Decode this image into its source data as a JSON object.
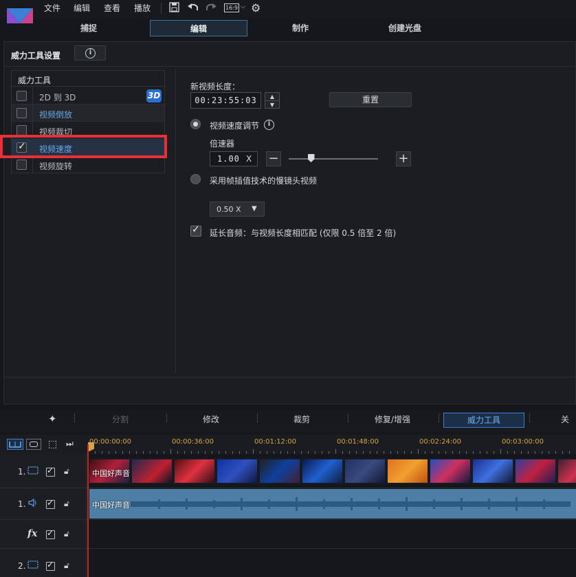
{
  "menu": [
    "文件",
    "编辑",
    "查看",
    "播放"
  ],
  "toolbar": {
    "aspect": "16:9"
  },
  "tabs": [
    {
      "label": "捕捉"
    },
    {
      "label": "编辑"
    },
    {
      "label": "制作"
    },
    {
      "label": "创建光盘"
    }
  ],
  "panel": {
    "title": "威力工具设置",
    "info": "i"
  },
  "tools": {
    "header": "威力工具",
    "items": [
      {
        "label": "2D 到 3D",
        "checked": false,
        "badge": "3D"
      },
      {
        "label": "视频倒放",
        "checked": false
      },
      {
        "label": "视频裁切",
        "checked": false
      },
      {
        "label": "视频速度",
        "checked": true
      },
      {
        "label": "视频旋转",
        "checked": false
      }
    ]
  },
  "settings": {
    "new_length_label": "新视频长度：",
    "new_length_value": "00:23:55:03",
    "reset_label": "重置",
    "speed_adjust_label": "视频速度调节",
    "multiplier_label": "倍速器",
    "multiplier_value": "1.00",
    "multiplier_unit": "X",
    "minus": "−",
    "plus": "+",
    "slider_level": 0.25,
    "interp_label": "采用帧插值技术的慢镜头视频",
    "interp_select": "0.50 X",
    "extend_audio_label": "延长音频：与视频长度相匹配 (仅限 0.5 倍至 2 倍)"
  },
  "bottom_tabs": [
    "分割",
    "修改",
    "裁剪",
    "修复/增强",
    "威力工具",
    "关键"
  ],
  "timeline": {
    "ticks": [
      "00:00:00:00",
      "00:00:36:00",
      "00:01:12:00",
      "00:01:48:00",
      "00:02:24:00",
      "00:03:00:00"
    ],
    "tracks": [
      {
        "num": "1.",
        "icon": "video-track-icon"
      },
      {
        "num": "1.",
        "icon": "audio-track-icon"
      },
      {
        "num": "",
        "icon": "fx-track-icon",
        "icon_text": "fx"
      },
      {
        "num": "2.",
        "icon": "video-track-icon"
      }
    ],
    "video_clip_label": "中国好声音",
    "audio_clip_label": "中国好声音"
  },
  "colors": {
    "accent": "#3e7ccf",
    "highlight_box": "#e8303a",
    "timecode": "#d6a34a",
    "audio_clip": "#4d7ea3"
  }
}
